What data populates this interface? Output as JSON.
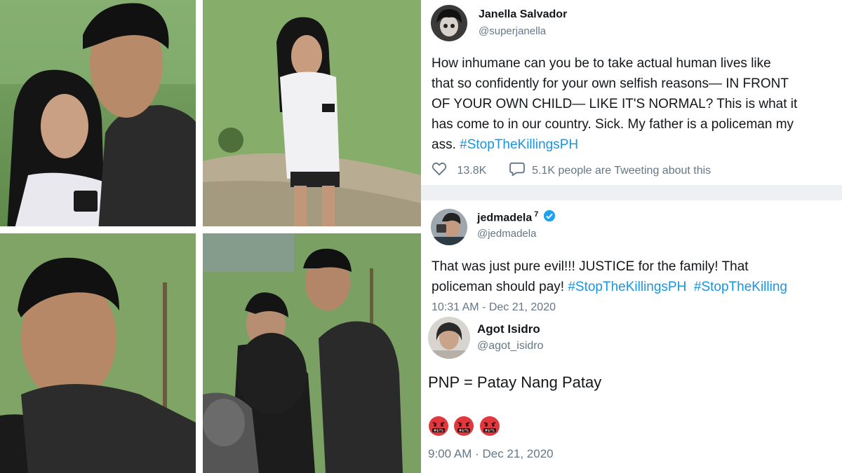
{
  "tweets": {
    "janella": {
      "name": "Janella Salvador",
      "handle": "@superjanella",
      "lines": [
        "How inhumane can you be to take actual human lives like",
        "that so confidently for your own selfish reasons— IN FRONT",
        "OF YOUR OWN CHILD— LIKE IT'S NORMAL? This is what it",
        "has come to in our country. Sick. My father is a policeman my",
        "ass."
      ],
      "hashtag": "#StopTheKillingsPH",
      "likes": "13.8K",
      "tweeting": "5.1K people are Tweeting about this",
      "icons": [
        "heart-icon",
        "speech-bubble-icon"
      ]
    },
    "jed": {
      "name": "jedmadela",
      "superscript": "7",
      "handle": "@jedmadela",
      "verified_icon": "verified-badge-icon",
      "line1": "That was just pure evil!!! JUSTICE for the family! That",
      "line2_prefix": "policeman should pay! ",
      "hashtag1": "#StopTheKillingsPH",
      "hashtag2": "#StopTheKilling",
      "timestamp": "10:31 AM - Dec 21, 2020"
    },
    "agot": {
      "name": "Agot Isidro",
      "handle": "@agot_isidro",
      "text": "PNP = Patay Nang Patay",
      "emojis": [
        "angry-face-icon",
        "angry-face-icon",
        "angry-face-icon"
      ],
      "emoji_label": "#$!%",
      "timestamp": "9:00 AM · Dec 21, 2020"
    }
  },
  "colors": {
    "hashtag": "#1b95e0",
    "text": "#14171a",
    "secondary": "#657786",
    "verified": "#1da1f2",
    "emoji": "#e0383e"
  }
}
